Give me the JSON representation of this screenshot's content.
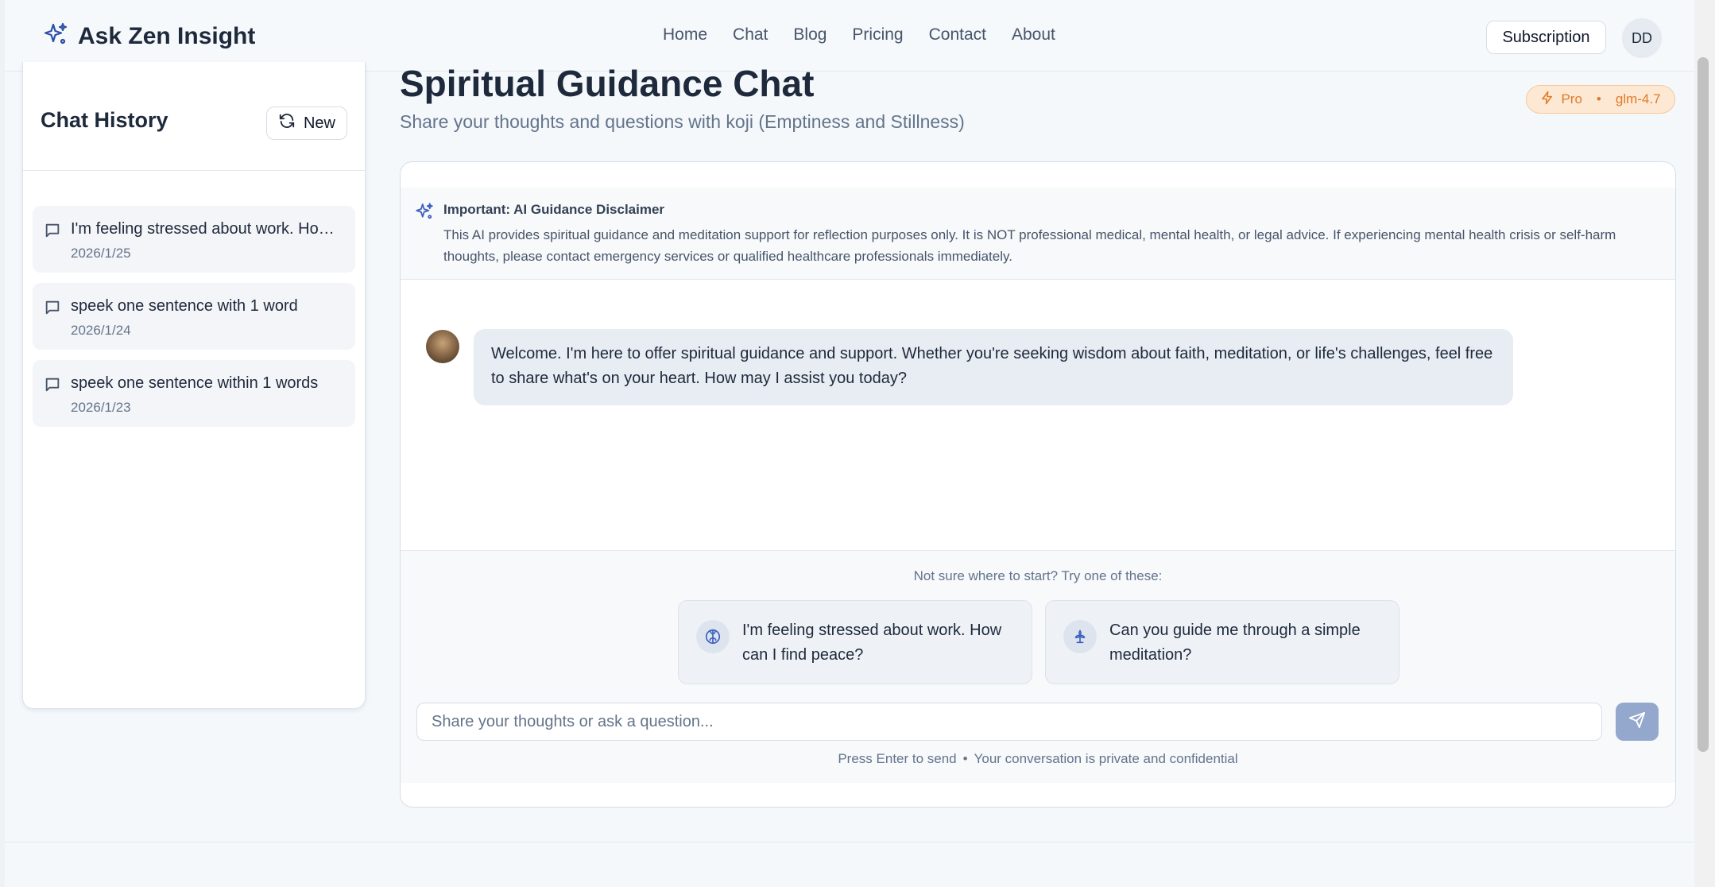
{
  "header": {
    "brand": "Ask Zen Insight",
    "nav": [
      "Home",
      "Chat",
      "Blog",
      "Pricing",
      "Contact",
      "About"
    ],
    "subscription_label": "Subscription",
    "user_initials": "DD"
  },
  "sidebar": {
    "title": "Chat History",
    "new_label": "New",
    "items": [
      {
        "title": "I'm feeling stressed about work. How can I find peace?",
        "date": "2026/1/25"
      },
      {
        "title": "speek one sentence with 1 word",
        "date": "2026/1/24"
      },
      {
        "title": "speek one sentence within 1 words",
        "date": "2026/1/23"
      }
    ]
  },
  "main": {
    "title": "Spiritual Guidance Chat",
    "subtitle": "Share your thoughts and questions with koji (Emptiness and Stillness)",
    "plan": "Pro",
    "model": "glm-4.7",
    "separator": "•"
  },
  "disclaimer": {
    "title": "Important: AI Guidance Disclaimer",
    "body": "This AI provides spiritual guidance and meditation support for reflection purposes only. It is NOT professional medical, mental health, or legal advice. If experiencing mental health crisis or self-harm thoughts, please contact emergency services or qualified healthcare professionals immediately."
  },
  "messages": [
    {
      "role": "assistant",
      "text": "Welcome. I'm here to offer spiritual guidance and support. Whether you're seeking wisdom about faith, meditation, or life's challenges, feel free to share what's on your heart. How may I assist you today?"
    }
  ],
  "composer": {
    "hint": "Not sure where to start? Try one of these:",
    "suggestions": [
      {
        "icon": "brain-icon",
        "text": "I'm feeling stressed about work. How can I find peace?"
      },
      {
        "icon": "lotus-icon",
        "text": "Can you guide me through a simple meditation?"
      }
    ],
    "input_placeholder": "Share your thoughts or ask a question...",
    "footer_send": "Press Enter to send",
    "footer_dot": "•",
    "footer_privacy": "Your conversation is private and confidential"
  },
  "colors": {
    "accent_blue": "#3b5fbf",
    "badge_orange": "#e07a2b",
    "send_button": "#93a8cc"
  }
}
